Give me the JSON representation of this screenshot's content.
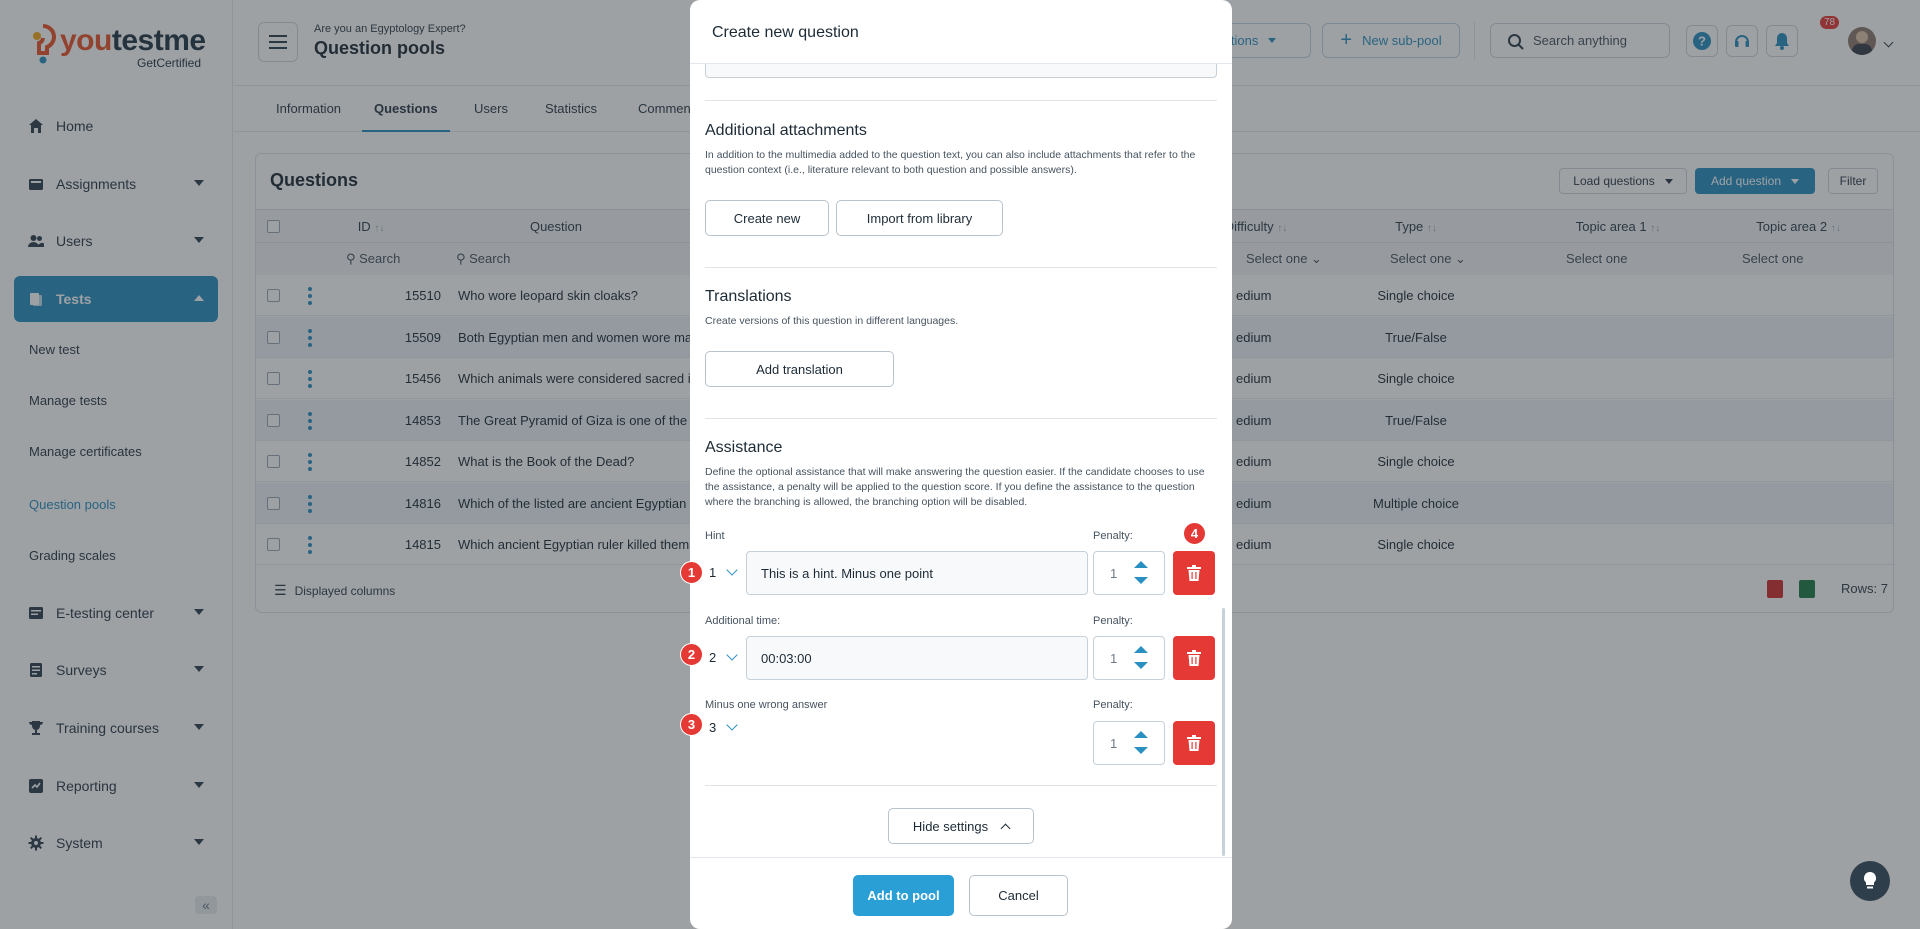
{
  "brand": {
    "name_a": "you",
    "name_b": "testme",
    "tagline": "GetCertified"
  },
  "sidebar": {
    "items": [
      {
        "label": "Home",
        "icon": "home-icon"
      },
      {
        "label": "Assignments",
        "icon": "assignments-icon"
      },
      {
        "label": "Users",
        "icon": "users-icon"
      },
      {
        "label": "Tests",
        "icon": "tests-icon"
      },
      {
        "label": "E-testing center",
        "icon": "e-testing-icon"
      },
      {
        "label": "Surveys",
        "icon": "surveys-icon"
      },
      {
        "label": "Training courses",
        "icon": "trophy-icon"
      },
      {
        "label": "Reporting",
        "icon": "reporting-icon"
      },
      {
        "label": "System",
        "icon": "gear-icon"
      }
    ],
    "tests_sub": [
      "New test",
      "Manage tests",
      "Manage certificates",
      "Question pools",
      "Grading scales"
    ]
  },
  "header": {
    "subtitle": "Are you an Egyptology Expert?",
    "title": "Question pools",
    "options_label": "Options",
    "new_subpool_label": "New sub-pool",
    "search_placeholder": "Search anything",
    "notification_count": "78"
  },
  "tabs": [
    "Information",
    "Questions",
    "Users",
    "Statistics",
    "Comments"
  ],
  "questions": {
    "title": "Questions",
    "load_label": "Load questions",
    "add_label": "Add question",
    "filter_label": "Filter",
    "columns": {
      "id": "ID",
      "question": "Question",
      "difficulty": "Difficulty",
      "type": "Type",
      "topic1": "Topic area 1",
      "topic2": "Topic area 2"
    },
    "filters": {
      "id": "Search",
      "question": "Search",
      "difficulty": "Select one",
      "type": "Select one",
      "topic1": "Select one",
      "topic2": "Select one"
    },
    "rows": [
      {
        "id": "15510",
        "question": "Who wore leopard skin cloaks?",
        "difficulty": "edium",
        "type": "Single choice"
      },
      {
        "id": "15509",
        "question": "Both Egyptian men and women wore mal",
        "difficulty": "edium",
        "type": "True/False"
      },
      {
        "id": "15456",
        "question": "Which animals were considered sacred in",
        "difficulty": "edium",
        "type": "Single choice"
      },
      {
        "id": "14853",
        "question": "The Great Pyramid of Giza is one of the S",
        "difficulty": "edium",
        "type": "True/False"
      },
      {
        "id": "14852",
        "question": "What is the Book of the Dead?",
        "difficulty": "edium",
        "type": "Single choice"
      },
      {
        "id": "14816",
        "question": "Which of the listed are ancient Egyptian g",
        "difficulty": "edium",
        "type": "Multiple choice"
      },
      {
        "id": "14815",
        "question": "Which ancient Egyptian ruler killed thems",
        "difficulty": "edium",
        "type": "Single choice"
      }
    ],
    "footer_columns": "Displayed columns",
    "rows_count": "Rows: 7"
  },
  "modal": {
    "title": "Create new question",
    "attachments": {
      "heading": "Additional attachments",
      "desc": "In addition to the multimedia added to the question text, you can also include attachments that refer to the question context (i.e., literature relevant to both question and possible answers).",
      "create_label": "Create new",
      "import_label": "Import from library"
    },
    "translations": {
      "heading": "Translations",
      "desc": "Create versions of this question in different languages.",
      "add_label": "Add translation"
    },
    "assistance": {
      "heading": "Assistance",
      "desc": "Define the optional assistance that will make answering the question easier. If the candidate chooses to use the assistance, a penalty will be applied to the question score. If you define the assistance to the question where the branching is allowed, the branching option will be disabled.",
      "penalty_label": "Penalty:",
      "items": [
        {
          "label": "Hint",
          "order": "1",
          "value": "This is a hint. Minus one point",
          "penalty": "1"
        },
        {
          "label": "Additional time:",
          "order": "2",
          "value": "00:03:00",
          "penalty": "1"
        },
        {
          "label": "Minus one wrong answer",
          "order": "3",
          "value": "",
          "penalty": "1"
        }
      ]
    },
    "hide_settings_label": "Hide settings",
    "add_to_pool_label": "Add to pool",
    "cancel_label": "Cancel"
  },
  "markers": [
    "1",
    "2",
    "3",
    "4"
  ],
  "colors": {
    "accent": "#2a8fc1",
    "danger": "#e53935",
    "brand_orange": "#e8552b"
  }
}
